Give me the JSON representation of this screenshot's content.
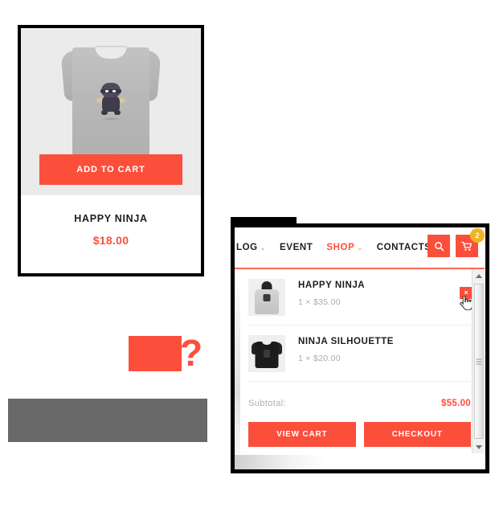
{
  "product_card": {
    "image_alt": "happy-ninja-grey-tshirt",
    "add_to_cart_label": "ADD TO CART",
    "title": "HAPPY NINJA",
    "price": "$18.00"
  },
  "cart_panel": {
    "nav": {
      "links": [
        {
          "label": "LOG",
          "caret": "⌄",
          "active": false
        },
        {
          "label": "EVENT",
          "caret": "",
          "active": false
        },
        {
          "label": "SHOP",
          "caret": "⌄",
          "active": true
        },
        {
          "label": "CONTACTS",
          "caret": "",
          "active": false
        }
      ],
      "search_icon": "search-icon",
      "cart_icon": "shopping-cart-icon",
      "cart_badge_count": "2"
    },
    "items": [
      {
        "name": "HAPPY NINJA",
        "qty_price": "1 × $35.00",
        "thumb": "grey-hoodie",
        "remove_label": "×"
      },
      {
        "name": "NINJA SILHOUETTE",
        "qty_price": "1 × $20.00",
        "thumb": "black-tshirt",
        "remove_label": "×"
      }
    ],
    "subtotal_label": "Subtotal:",
    "subtotal_value": "$55.00",
    "view_cart_label": "VIEW CART",
    "checkout_label": "CHECKOUT"
  },
  "fragments": {
    "red_glyph": "?"
  },
  "colors": {
    "accent_red": "#fb4f3c",
    "badge_yellow": "#f0b323",
    "panel_border": "#000000",
    "grey_bar": "#696969",
    "muted_text": "#aaaaaa"
  }
}
